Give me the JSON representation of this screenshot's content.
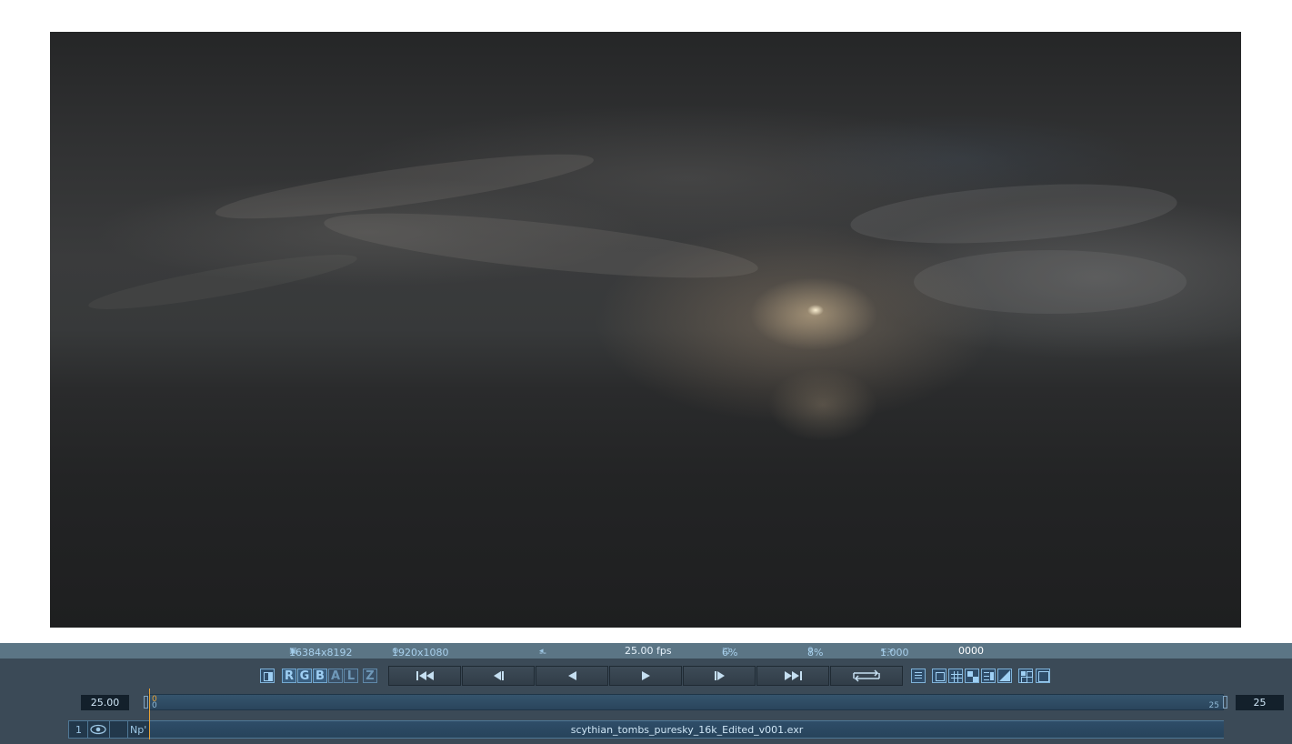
{
  "viewer": {
    "image_name": "scythian_tombs_puresky_16k_Edited_v001.exr"
  },
  "status": {
    "source_res": "16384x8192",
    "output_res": "1920x1080",
    "audio": "--",
    "fps": "25.00 fps",
    "cache": "6%",
    "zoom": "8%",
    "gamma": "1.000",
    "frame": "0000"
  },
  "icons": {
    "source_res": "frame-icon",
    "output_res": "output-res-icon",
    "audio": "speaker-icon",
    "cache": "cache-icon",
    "zoom": "magnifier-icon",
    "gamma": "gamma-icon",
    "compare": "split-view-icon",
    "transport": [
      "go-to-start-icon",
      "step-back-icon",
      "play-reverse-icon",
      "play-icon",
      "step-forward-icon",
      "go-to-end-icon",
      "loop-icon"
    ],
    "view_modes": [
      "list-icon",
      "safe-frame-icon",
      "grid-icon",
      "checker-icon",
      "stack-icon",
      "wipe-icon",
      "layout-icon",
      "fullscreen-icon"
    ],
    "layer_visibility": "eye-icon"
  },
  "channels": [
    "R",
    "G",
    "B",
    "A",
    "L",
    "Z"
  ],
  "timeline": {
    "fps_value": "25.00",
    "start_top": "0",
    "start_bottom": "0",
    "end_tick": "25",
    "end_frame": "25"
  },
  "layer": {
    "index": "1",
    "mode": "Np'",
    "clip_name": "scythian_tombs_puresky_16k_Edited_v001.exr"
  },
  "colors": {
    "status_bar": "#5b7585",
    "panel": "#3b4a57",
    "accent": "#73a8d0",
    "playhead": "#e8a236"
  }
}
